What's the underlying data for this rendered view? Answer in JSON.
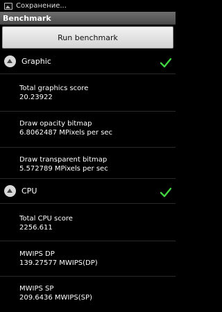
{
  "status_bar": {
    "notification_text": "Сохранение..."
  },
  "title_bar": {
    "title": "Benchmark"
  },
  "run_button": {
    "label": "Run benchmark"
  },
  "sections": {
    "graphic": {
      "title": "Graphic",
      "items": [
        {
          "label": "Total graphics score",
          "value": "20.23922"
        },
        {
          "label": "Draw opacity bitmap",
          "value": "6.8062487 MPixels per sec"
        },
        {
          "label": "Draw transparent bitmap",
          "value": "5.572789 MPixels per sec"
        }
      ]
    },
    "cpu": {
      "title": "CPU",
      "items": [
        {
          "label": "Total CPU score",
          "value": "2256.611"
        },
        {
          "label": "MWIPS DP",
          "value": "139.27577 MWIPS(DP)"
        },
        {
          "label": "MWIPS SP",
          "value": "209.6436 MWIPS(SP)"
        }
      ]
    }
  },
  "colors": {
    "check": "#3fd63f",
    "title_bar": "#5a5a5a",
    "button": "#e4e4e4"
  }
}
